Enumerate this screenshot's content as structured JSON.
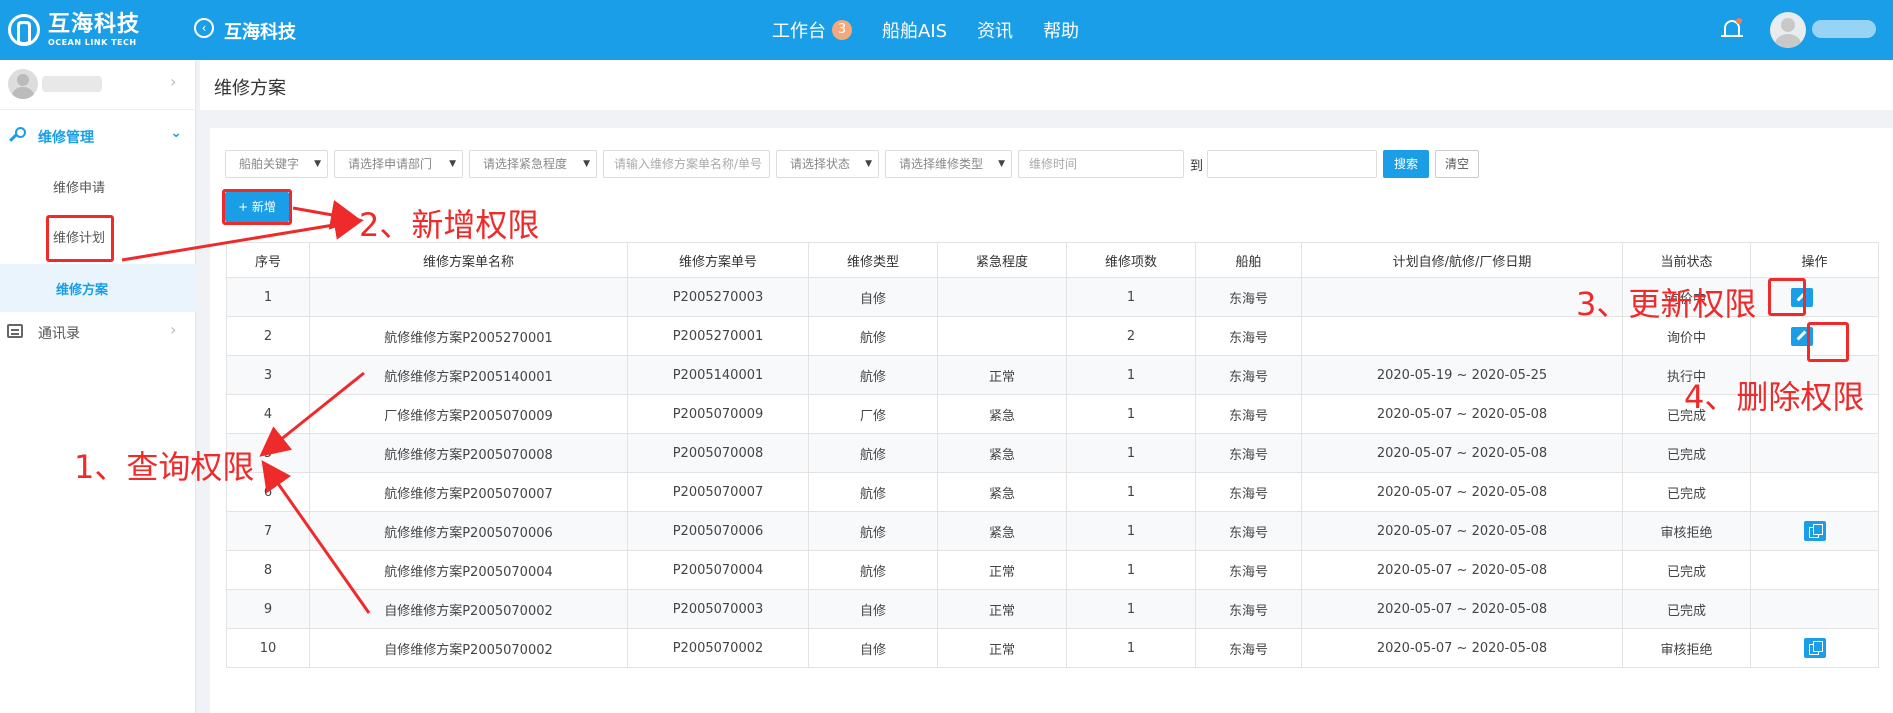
{
  "header": {
    "logo_cn": "互海科技",
    "logo_en": "OCEAN LINK TECH",
    "app_title": "互海科技",
    "nav": [
      {
        "label": "工作台",
        "badge": "3"
      },
      {
        "label": "船舶AIS"
      },
      {
        "label": "资讯"
      },
      {
        "label": "帮助"
      }
    ],
    "accent_color": "#1a9ee8"
  },
  "sidebar": {
    "group_label": "维修管理",
    "items": [
      {
        "label": "维修申请"
      },
      {
        "label": "维修计划"
      },
      {
        "label": "维修方案"
      }
    ],
    "contacts_label": "通讯录"
  },
  "page": {
    "title": "维修方案"
  },
  "filters": {
    "ship_keyword": "船舶关键字",
    "dept": "请选择申请部门",
    "urgency": "请选择紧急程度",
    "plan_input_placeholder": "请输入维修方案单名称/单号",
    "status": "请选择状态",
    "type": "请选择维修类型",
    "time_placeholder": "维修时间",
    "to_label": "到",
    "search_label": "搜索",
    "clear_label": "清空"
  },
  "toolbar": {
    "add_label": "+ 新增"
  },
  "table": {
    "columns": [
      "序号",
      "维修方案单名称",
      "维修方案单号",
      "维修类型",
      "紧急程度",
      "维修项数",
      "船舶",
      "计划自修/航修/厂修日期",
      "当前状态",
      "操作"
    ],
    "rows": [
      [
        "1",
        "",
        "P2005270003",
        "自修",
        "",
        "1",
        "东海号",
        "",
        "询价中"
      ],
      [
        "2",
        "航修维修方案P2005270001",
        "P2005270001",
        "航修",
        "",
        "2",
        "东海号",
        "",
        "询价中"
      ],
      [
        "3",
        "航修维修方案P2005140001",
        "P2005140001",
        "航修",
        "正常",
        "1",
        "东海号",
        "2020-05-19 ~ 2020-05-25",
        "执行中"
      ],
      [
        "4",
        "厂修维修方案P2005070009",
        "P2005070009",
        "厂修",
        "紧急",
        "1",
        "东海号",
        "2020-05-07 ~ 2020-05-08",
        "已完成"
      ],
      [
        "5",
        "航修维修方案P2005070008",
        "P2005070008",
        "航修",
        "紧急",
        "1",
        "东海号",
        "2020-05-07 ~ 2020-05-08",
        "已完成"
      ],
      [
        "6",
        "航修维修方案P2005070007",
        "P2005070007",
        "航修",
        "紧急",
        "1",
        "东海号",
        "2020-05-07 ~ 2020-05-08",
        "已完成"
      ],
      [
        "7",
        "航修维修方案P2005070006",
        "P2005070006",
        "航修",
        "紧急",
        "1",
        "东海号",
        "2020-05-07 ~ 2020-05-08",
        "审核拒绝"
      ],
      [
        "8",
        "航修维修方案P2005070004",
        "P2005070004",
        "航修",
        "正常",
        "1",
        "东海号",
        "2020-05-07 ~ 2020-05-08",
        "已完成"
      ],
      [
        "9",
        "自修维修方案P2005070002",
        "P2005070003",
        "自修",
        "正常",
        "1",
        "东海号",
        "2020-05-07 ~ 2020-05-08",
        "已完成"
      ],
      [
        "10",
        "自修维修方案P2005070002",
        "P2005070002",
        "自修",
        "正常",
        "1",
        "东海号",
        "2020-05-07 ~ 2020-05-08",
        "审核拒绝"
      ]
    ],
    "row_ops": [
      [
        "edit",
        "delete"
      ],
      [
        "edit",
        "delete"
      ],
      [],
      [],
      [],
      [],
      [
        "copy"
      ],
      [],
      [],
      [
        "copy"
      ]
    ]
  },
  "annotations": {
    "query": "1、查询权限",
    "add": "2、新增权限",
    "update": "3、更新权限",
    "delete": "4、删除权限",
    "color": "#ef2a2a"
  }
}
